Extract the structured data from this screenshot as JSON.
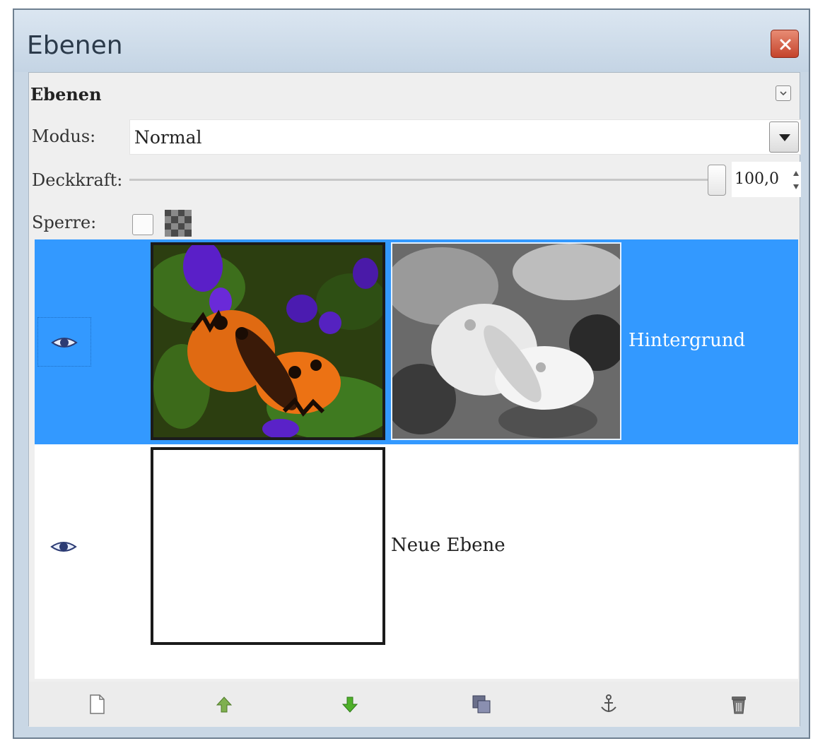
{
  "window": {
    "title": "Ebenen"
  },
  "panel": {
    "tab_label": "Ebenen",
    "mode_label": "Modus:",
    "mode_value": "Normal",
    "opacity_label": "Deckkraft:",
    "opacity_value": "100,0",
    "opacity_percent": 100,
    "lock_label": "Sperre:"
  },
  "layers": [
    {
      "name": "Hintergrund",
      "visible": true,
      "selected": true,
      "has_mask": true,
      "thumbnail": "butterfly-photo"
    },
    {
      "name": "Neue Ebene",
      "visible": true,
      "selected": false,
      "has_mask": false,
      "thumbnail": "empty-white"
    }
  ],
  "toolbar_icons": [
    "new-layer-icon",
    "raise-layer-icon",
    "lower-layer-icon",
    "duplicate-layer-icon",
    "anchor-layer-icon",
    "delete-layer-icon"
  ],
  "colors": {
    "selection": "#3399ff",
    "selected_text": "#ffffff",
    "titlebar": "#c9d7e5",
    "close_button": "#d9553d"
  }
}
